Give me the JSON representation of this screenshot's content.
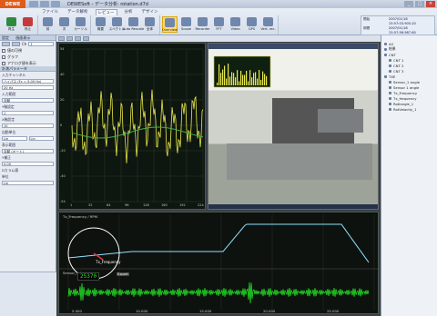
{
  "app": {
    "logo": "DEWE",
    "title": "DEWESoft - データ分析: rotation.d7d",
    "window_controls": [
      "_",
      "□",
      "×"
    ]
  },
  "ribbon": {
    "tabs": [
      "ファイル",
      "データ解析",
      "レビュー",
      "分析",
      "デザイン"
    ],
    "active_tab": "レビュー",
    "groups": [
      {
        "buttons": [
          {
            "label": "再生",
            "icon": "play-icon"
          },
          {
            "label": "停止",
            "icon": "stop-icon"
          }
        ]
      },
      {
        "buttons": [
          {
            "label": "前",
            "icon": "prev-icon"
          },
          {
            "label": "次",
            "icon": "next-icon"
          },
          {
            "label": "カーソル",
            "icon": "cursor-icon"
          }
        ]
      },
      {
        "buttons": [
          {
            "label": "概要",
            "icon": "overview-icon"
          },
          {
            "label": "スペクトル",
            "icon": "spectrum-icon"
          },
          {
            "label": "Auto Rescale",
            "icon": "rescale-icon"
          },
          {
            "label": "全体",
            "icon": "full-icon"
          }
        ]
      },
      {
        "buttons": [
          {
            "label": "Overview",
            "icon": "overview-screen-icon",
            "selected": true
          },
          {
            "label": "Scope",
            "icon": "scope-icon"
          },
          {
            "label": "Recorder",
            "icon": "recorder-icon"
          },
          {
            "label": "FFT",
            "icon": "fft-icon"
          },
          {
            "label": "Video",
            "icon": "video-icon"
          },
          {
            "label": "GPS",
            "icon": "gps-icon"
          },
          {
            "label": "Vert. rec.",
            "icon": "vert-rec-icon"
          }
        ]
      }
    ],
    "store_info": [
      {
        "k": "開始",
        "v": "2007/01/18 15:57:03.905.20"
      },
      {
        "k": "期間",
        "v": "2007/01/18 15:57:56.987.60"
      },
      {
        "k": "記録",
        "v": "00:00:53.08"
      }
    ]
  },
  "left_panel": {
    "header1": "設定",
    "header1b": "画面表示",
    "ch_label": "Ch",
    "ch_value": "1",
    "row_check1": "値の可視",
    "row_check2": "グラフ",
    "row_check3": "アナログ値を表示",
    "section2": "計測パラメータ",
    "f1_label": "入力チャンネル",
    "f1_value": "ハイパス (Fc = 5.00 Hz)",
    "f2_value": "20 Hz",
    "f3_label": "入力範囲",
    "f3_value": "自動",
    "f4_label": "Y軸設定",
    "f4_value": "1",
    "f5_label": "X軸設定",
    "f5_value": "10",
    "f6_label": "自動単位",
    "f6_value": "Lin",
    "f7_label": "Lin",
    "f8_label": "表示範囲",
    "f8_value": "自動 (オート)",
    "f9_label": "Y補正",
    "f9_value": "0.00",
    "f10_label": "Dカラム値",
    "f11_label": "単位",
    "f11_value": "Lin"
  },
  "right_panel": {
    "items": [
      {
        "label": "All",
        "sub": false
      },
      {
        "label": "結果",
        "sub": false
      },
      {
        "label": "CNT",
        "sub": false
      },
      {
        "label": "CNT 1",
        "sub": true
      },
      {
        "label": "CNT 2",
        "sub": true
      },
      {
        "label": "CNT 3",
        "sub": true
      },
      {
        "label": "TXE",
        "sub": false
      },
      {
        "label": "Sensor_1 angle",
        "sub": true
      },
      {
        "label": "Sensor 1 angle",
        "sub": true
      },
      {
        "label": "Tx_Frequency",
        "sub": true
      },
      {
        "label": "Tx_frequency",
        "sub": true
      },
      {
        "label": "Rotlangle_1",
        "sub": true
      },
      {
        "label": "RotVelocity_1",
        "sub": true
      }
    ]
  },
  "timeplot": {
    "y_ticks": [
      "54",
      "40",
      "20",
      "0",
      "-20",
      "-40",
      "-54"
    ],
    "x_ticks": [
      "1",
      "32",
      "64",
      "96",
      "128",
      "160",
      "192",
      "224"
    ]
  },
  "bottom": {
    "top_label": "Tx_Frequency / RPM",
    "bottom_label": "Sensor_1 / g",
    "rpm_value": "25370",
    "tx_label": "Tx_Frequency",
    "export_label": "Export",
    "time_ticks": [
      "5.000",
      "10.000",
      "15.000",
      "20.000",
      "25.000"
    ]
  }
}
